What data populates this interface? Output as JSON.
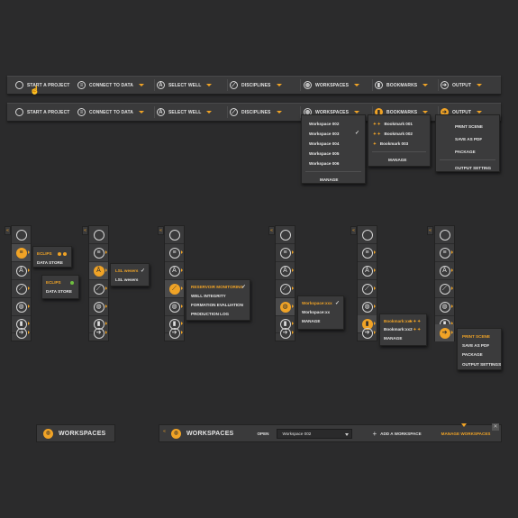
{
  "toolbar": {
    "items": [
      {
        "label": "START A PROJECT",
        "icon": "circle-icon"
      },
      {
        "label": "CONNECT TO DATA",
        "icon": "database-icon"
      },
      {
        "label": "SELECT WELL",
        "icon": "well-icon"
      },
      {
        "label": "DISCIPLINES",
        "icon": "disciplines-icon"
      },
      {
        "label": "WORKSPACES",
        "icon": "workspaces-icon"
      },
      {
        "label": "BOOKMARKS",
        "icon": "bookmark-icon"
      },
      {
        "label": "OUTPUT",
        "icon": "output-icon"
      }
    ]
  },
  "workspaces_menu": {
    "items": [
      "Workspace 002",
      "Workspace 003",
      "Workspace 004",
      "Workspace 005",
      "Workspace 006"
    ],
    "checked": "Workspace 003",
    "manage": "MANAGE"
  },
  "bookmarks_menu": {
    "items": [
      "Bookmark 001",
      "Bookmark 002",
      "Bookmark 003"
    ],
    "manage": "MANAGE"
  },
  "output_menu": {
    "items": [
      "PRINT SCENE",
      "SAVE AS PDF",
      "PACKAGE",
      "OUTPUT SETTING"
    ]
  },
  "vertical": {
    "connect_menu": {
      "item1": "ECLIPS",
      "item2": "DATA STORE",
      "item3": "ECLIPS",
      "item4": "DATA STORE"
    },
    "well_menu": {
      "item1": "LSL wesers",
      "item2": "LSL wesers"
    },
    "disciplines_menu": {
      "items": [
        "RESERVOIR MONITORING",
        "WELL INTEGRITY",
        "FORMATION EVALUATION",
        "PRODUCTION LOG"
      ]
    },
    "workspaces_menu": {
      "items": [
        "Workspace:xxx",
        "Workspace:xx"
      ],
      "manage": "MANAGE"
    },
    "bookmarks_menu": {
      "items": [
        "Bookmark:xxx",
        "Bookmark:xx2"
      ],
      "manage": "MANAGE"
    },
    "output_menu": {
      "items": [
        "PRINT SCENE",
        "SAVE AS PDF",
        "PACKAGE",
        "OUTPUT SETTINGS"
      ]
    }
  },
  "ws_panel_small": {
    "title": "WORKSPACES"
  },
  "ws_panel_large": {
    "title": "WORKSPACES",
    "open_label": "OPEN",
    "select_value": "Workspace 002",
    "add_label": "ADD A WORKSPACE",
    "manage_label": "MANAGE WORKSPACES",
    "close": "✕"
  },
  "colors": {
    "accent": "#f0a326",
    "background": "#2b2b2c",
    "bar": "#3a3a3b",
    "green": "#6fbf3f"
  }
}
